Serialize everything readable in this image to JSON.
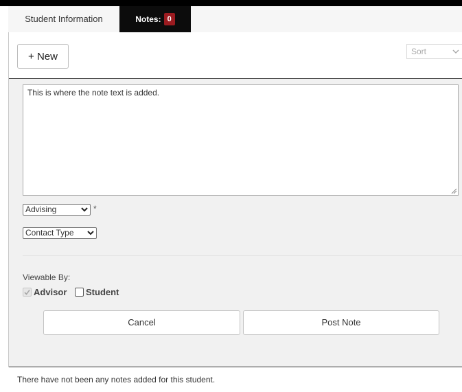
{
  "tabs": [
    {
      "label": "Student Information"
    },
    {
      "label": "Notes:",
      "badge": "0"
    }
  ],
  "toolbar": {
    "new_label": "+ New",
    "sort_label": "Sort"
  },
  "form": {
    "note_text": "This is where the note text is added.",
    "category_value": "Advising",
    "required_marker": "*",
    "contact_type_value": "Contact Type",
    "viewable_by_label": "Viewable By:",
    "advisor_label": "Advisor",
    "advisor_checked": true,
    "advisor_disabled": true,
    "student_label": "Student",
    "student_checked": false,
    "cancel_label": "Cancel",
    "post_label": "Post Note"
  },
  "empty_message": "There have not been any notes added for this student.",
  "colors": {
    "active_tab_bg": "#0c0c0c",
    "badge_bg": "#9b1b20",
    "panel_bg": "#f1f1f1"
  }
}
